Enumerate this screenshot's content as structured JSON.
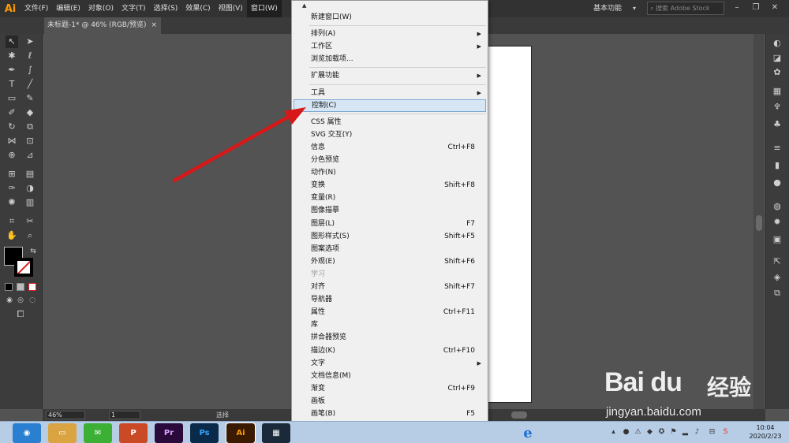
{
  "app": {
    "logo": "Ai",
    "menubar": [
      "文件(F)",
      "编辑(E)",
      "对象(O)",
      "文字(T)",
      "选择(S)",
      "效果(C)",
      "视图(V)",
      "窗口(W)"
    ],
    "workspace_label": "基本功能",
    "stock_search_placeholder": "搜索 Adobe Stock"
  },
  "document_tab": {
    "title": "未标题-1* @ 46% (RGB/预览)",
    "close": "×"
  },
  "status": {
    "zoom": "46%",
    "page": "1",
    "tool": "选择"
  },
  "window_menu": {
    "items": [
      {
        "label": "新建窗口(W)",
        "shortcut": "",
        "submenu": false
      },
      {
        "label": "排列(A)",
        "shortcut": "",
        "submenu": true
      },
      {
        "label": "工作区",
        "shortcut": "",
        "submenu": true
      },
      {
        "label": "浏览加载项...",
        "shortcut": "",
        "submenu": false
      },
      {
        "label": "扩展功能",
        "shortcut": "",
        "submenu": true
      },
      {
        "label": "工具",
        "shortcut": "",
        "submenu": true
      },
      {
        "label": "控制(C)",
        "shortcut": "",
        "submenu": false,
        "highlighted": true
      },
      {
        "label": "CSS 属性",
        "shortcut": "",
        "submenu": false
      },
      {
        "label": "SVG 交互(Y)",
        "shortcut": "",
        "submenu": false
      },
      {
        "label": "信息",
        "shortcut": "Ctrl+F8",
        "submenu": false
      },
      {
        "label": "分色预览",
        "shortcut": "",
        "submenu": false
      },
      {
        "label": "动作(N)",
        "shortcut": "",
        "submenu": false
      },
      {
        "label": "变换",
        "shortcut": "Shift+F8",
        "submenu": false
      },
      {
        "label": "变量(R)",
        "shortcut": "",
        "submenu": false
      },
      {
        "label": "图像描摹",
        "shortcut": "",
        "submenu": false
      },
      {
        "label": "图层(L)",
        "shortcut": "F7",
        "submenu": false
      },
      {
        "label": "图形样式(S)",
        "shortcut": "Shift+F5",
        "submenu": false
      },
      {
        "label": "图案选项",
        "shortcut": "",
        "submenu": false
      },
      {
        "label": "外观(E)",
        "shortcut": "Shift+F6",
        "submenu": false
      },
      {
        "label": "学习",
        "shortcut": "",
        "submenu": false,
        "disabled": true
      },
      {
        "label": "对齐",
        "shortcut": "Shift+F7",
        "submenu": false
      },
      {
        "label": "导航器",
        "shortcut": "",
        "submenu": false
      },
      {
        "label": "属性",
        "shortcut": "Ctrl+F11",
        "submenu": false
      },
      {
        "label": "库",
        "shortcut": "",
        "submenu": false
      },
      {
        "label": "拼合器预览",
        "shortcut": "",
        "submenu": false
      },
      {
        "label": "描边(K)",
        "shortcut": "Ctrl+F10",
        "submenu": false
      },
      {
        "label": "文字",
        "shortcut": "",
        "submenu": true
      },
      {
        "label": "文档信息(M)",
        "shortcut": "",
        "submenu": false
      },
      {
        "label": "渐变",
        "shortcut": "Ctrl+F9",
        "submenu": false
      },
      {
        "label": "画板",
        "shortcut": "",
        "submenu": false
      },
      {
        "label": "画笔(B)",
        "shortcut": "F5",
        "submenu": false
      }
    ]
  },
  "taskbar": {
    "apps": [
      {
        "name": "browser",
        "label": "◉",
        "color": "#2a7fd0"
      },
      {
        "name": "file-explorer",
        "label": "▭",
        "color": "#d9a441"
      },
      {
        "name": "wechat",
        "label": "✉",
        "color": "#3cb034"
      },
      {
        "name": "powerpoint",
        "label": "P",
        "color": "#c94a25"
      },
      {
        "name": "premiere",
        "label": "Pr",
        "color": "#2a0a3a"
      },
      {
        "name": "photoshop",
        "label": "Ps",
        "color": "#0a2a4a"
      },
      {
        "name": "illustrator",
        "label": "Ai",
        "color": "#3a1a00"
      },
      {
        "name": "video-editor",
        "label": "▦",
        "color": "#1a2a3a"
      }
    ],
    "ie_label": "e",
    "time": "10:04",
    "date": "2020/2/23"
  },
  "watermark": {
    "brand": "Bai du",
    "suffix": "经验",
    "url": "jingyan.baidu.com"
  },
  "colors": {
    "menu_bar_bg": "#323232",
    "panel_bg": "#3c3c3c",
    "canvas_bg": "#535353",
    "highlight": "#d6e6f5",
    "arrow": "#d81818",
    "ai_orange": "#ff9a00"
  }
}
